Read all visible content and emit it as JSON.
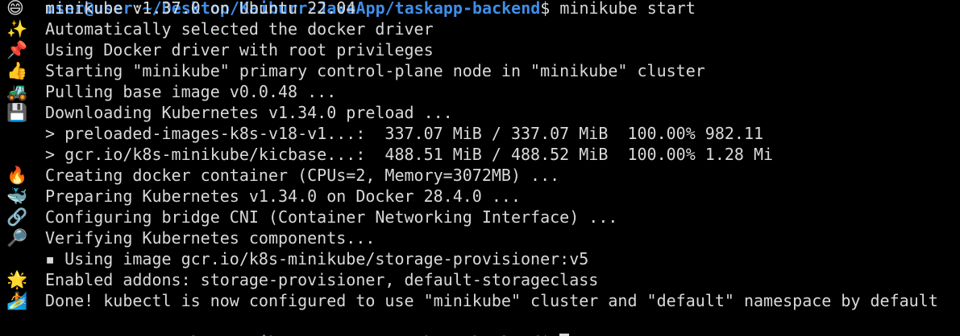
{
  "colors": {
    "background": "#000000",
    "text": "#d9d9d9",
    "prompt": "#3f8ee8"
  },
  "prompt": {
    "user": "user@user",
    "separator": ":",
    "path": "~/Desktop/Kaiburr-JavaApp/taskapp-backend",
    "symbol": "$",
    "command": " minikube start"
  },
  "output": [
    {
      "icon": "😄",
      "icon_name": "smile-icon",
      "text": "minikube v1.37.0 on Ubuntu 22.04"
    },
    {
      "icon": "✨",
      "icon_name": "sparkles-icon",
      "text": "Automatically selected the docker driver"
    },
    {
      "icon": "📌",
      "icon_name": "pushpin-icon",
      "text": "Using Docker driver with root privileges"
    },
    {
      "icon": "👍",
      "icon_name": "thumbs-up-icon",
      "text": "Starting \"minikube\" primary control-plane node in \"minikube\" cluster"
    },
    {
      "icon": "🚜",
      "icon_name": "tractor-icon",
      "text": "Pulling base image v0.0.48 ..."
    },
    {
      "icon": "💾",
      "icon_name": "floppy-disk-icon",
      "text": "Downloading Kubernetes v1.34.0 preload ..."
    },
    {
      "icon": "",
      "icon_name": "",
      "text": "> preloaded-images-k8s-v18-v1...:  337.07 MiB / 337.07 MiB  100.00% 982.11"
    },
    {
      "icon": "",
      "icon_name": "",
      "text": "> gcr.io/k8s-minikube/kicbase...:  488.51 MiB / 488.52 MiB  100.00% 1.28 Mi"
    },
    {
      "icon": "🔥",
      "icon_name": "fire-icon",
      "text": "Creating docker container (CPUs=2, Memory=3072MB) ..."
    },
    {
      "icon": "🐳",
      "icon_name": "whale-icon",
      "text": "Preparing Kubernetes v1.34.0 on Docker 28.4.0 ..."
    },
    {
      "icon": "🔗",
      "icon_name": "link-icon",
      "text": "Configuring bridge CNI (Container Networking Interface) ..."
    },
    {
      "icon": "🔎",
      "icon_name": "magnifier-icon",
      "text": "Verifying Kubernetes components..."
    },
    {
      "icon": "",
      "icon_name": "",
      "text": "▪ Using image gcr.io/k8s-minikube/storage-provisioner:v5"
    },
    {
      "icon": "🌟",
      "icon_name": "glowing-star-icon",
      "text": "Enabled addons: storage-provisioner, default-storageclass"
    },
    {
      "icon": "🏄",
      "icon_name": "surfer-icon",
      "text": "Done! kubectl is now configured to use \"minikube\" cluster and \"default\" namespace by default"
    }
  ]
}
